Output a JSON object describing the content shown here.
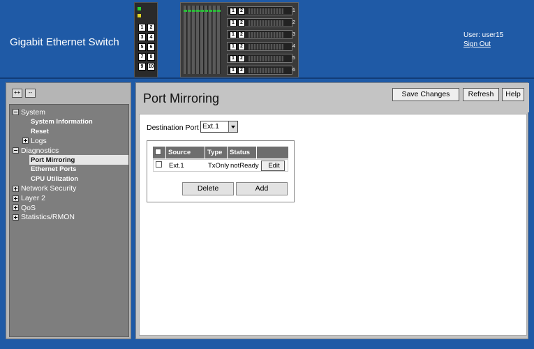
{
  "header": {
    "app_title": "Gigabit Ethernet Switch",
    "user_label": "User: user15",
    "sign_out": "Sign Out"
  },
  "switch_graphic": {
    "left_ports": [
      [
        "1",
        "2"
      ],
      [
        "3",
        "4"
      ],
      [
        "5",
        "6"
      ],
      [
        "7",
        "8"
      ],
      [
        "9",
        "10"
      ]
    ],
    "bays": [
      {
        "n1": "1",
        "n2": "2",
        "label": "1"
      },
      {
        "n1": "1",
        "n2": "2",
        "label": "2"
      },
      {
        "n1": "1",
        "n2": "2",
        "label": "3"
      },
      {
        "n1": "1",
        "n2": "2",
        "label": "4"
      },
      {
        "n1": "1",
        "n2": "2",
        "label": "5"
      },
      {
        "n1": "1",
        "n2": "2",
        "label": "6"
      }
    ]
  },
  "nav": {
    "expand_all": "++",
    "collapse_all": "--",
    "items": [
      {
        "label": "System",
        "level": 0,
        "toggle": "minus"
      },
      {
        "label": "System Information",
        "level": 2
      },
      {
        "label": "Reset",
        "level": 2
      },
      {
        "label": "Logs",
        "level": 1,
        "toggle": "plus"
      },
      {
        "label": "Diagnostics",
        "level": 0,
        "toggle": "minus"
      },
      {
        "label": "Port Mirroring",
        "level": 2,
        "selected": true
      },
      {
        "label": "Ethernet Ports",
        "level": 2
      },
      {
        "label": "CPU Utilization",
        "level": 2
      },
      {
        "label": "Network Security",
        "level": 0,
        "toggle": "plus"
      },
      {
        "label": "Layer 2",
        "level": 0,
        "toggle": "plus"
      },
      {
        "label": "QoS",
        "level": 0,
        "toggle": "plus"
      },
      {
        "label": "Statistics/RMON",
        "level": 0,
        "toggle": "plus"
      }
    ]
  },
  "main": {
    "page_title": "Port Mirroring",
    "save_changes": "Save Changes",
    "refresh": "Refresh",
    "help": "Help",
    "destination_port_label": "Destination Port",
    "destination_port_value": "Ext.1",
    "table": {
      "headers": [
        "Source Port",
        "Type",
        "Status"
      ],
      "rows": [
        {
          "source_port": "Ext.1",
          "type": "TxOnly",
          "status": "notReady",
          "edit": "Edit"
        }
      ]
    },
    "delete": "Delete",
    "add": "Add"
  },
  "colors": {
    "header_bg": "#1f5aa6",
    "nav_tree_bg": "#7e7e7e",
    "panel_bg": "#c4c4c4",
    "table_header_bg": "#6e6e6e"
  }
}
